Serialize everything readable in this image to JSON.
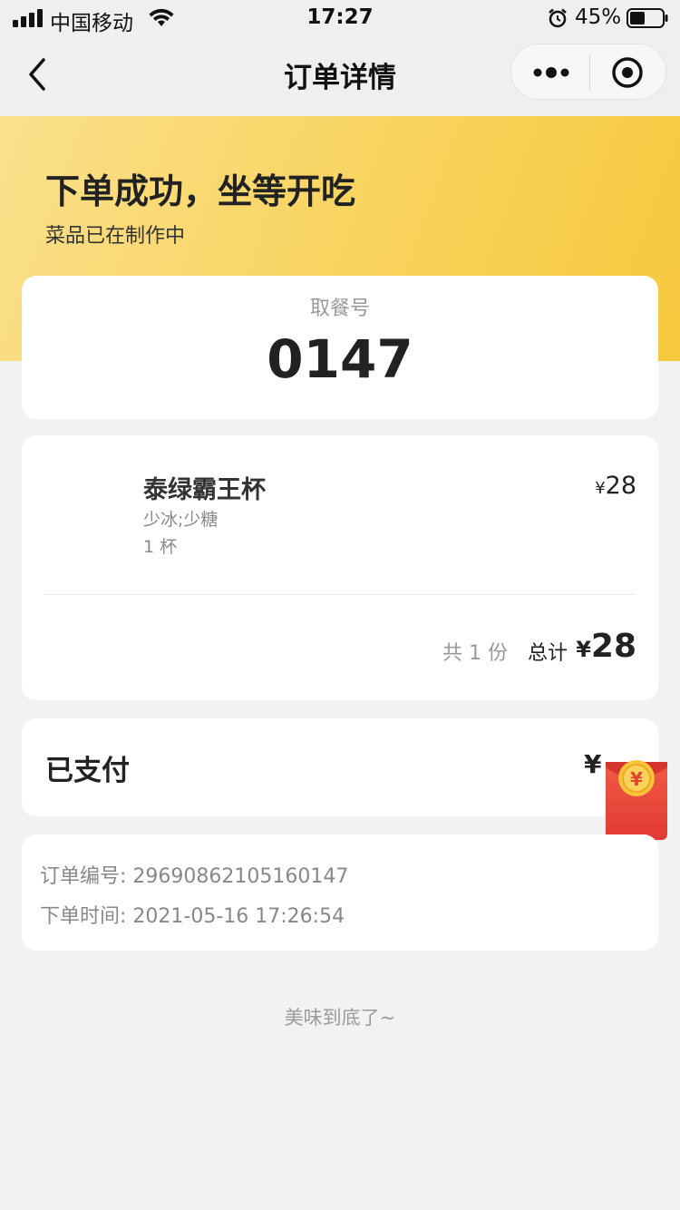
{
  "status_bar": {
    "carrier": "中国移动",
    "time": "17:27",
    "battery": "45%"
  },
  "nav": {
    "title": "订单详情"
  },
  "banner": {
    "title": "下单成功，坐等开吃",
    "subtitle": "菜品已在制作中"
  },
  "pickup": {
    "label": "取餐号",
    "number": "0147"
  },
  "order_item": {
    "name": "泰绿霸王杯",
    "options": "少冰;少糖",
    "quantity": "1 杯",
    "currency": "¥",
    "price": "28"
  },
  "summary": {
    "count": "共 1 份",
    "total_label": "总计",
    "currency": "¥",
    "total": "28"
  },
  "payment": {
    "status": "已支付",
    "amount_visible": "¥"
  },
  "order_info": {
    "order_no_label": "订单编号:",
    "order_no": "29690862105160147",
    "order_time_label": "下单时间:",
    "order_time": "2021-05-16 17:26:54"
  },
  "footer": {
    "text": "美味到底了~"
  },
  "colors": {
    "banner_start": "#fbe08c",
    "banner_end": "#f6c83d",
    "page_bg": "#f2f2f2",
    "redpacket": "#e8453c",
    "coin": "#f7c236"
  },
  "icons": [
    "signal-icon",
    "wifi-icon",
    "alarm-icon",
    "battery-icon",
    "back-icon",
    "more-icon",
    "close-icon",
    "red-packet-icon"
  ]
}
